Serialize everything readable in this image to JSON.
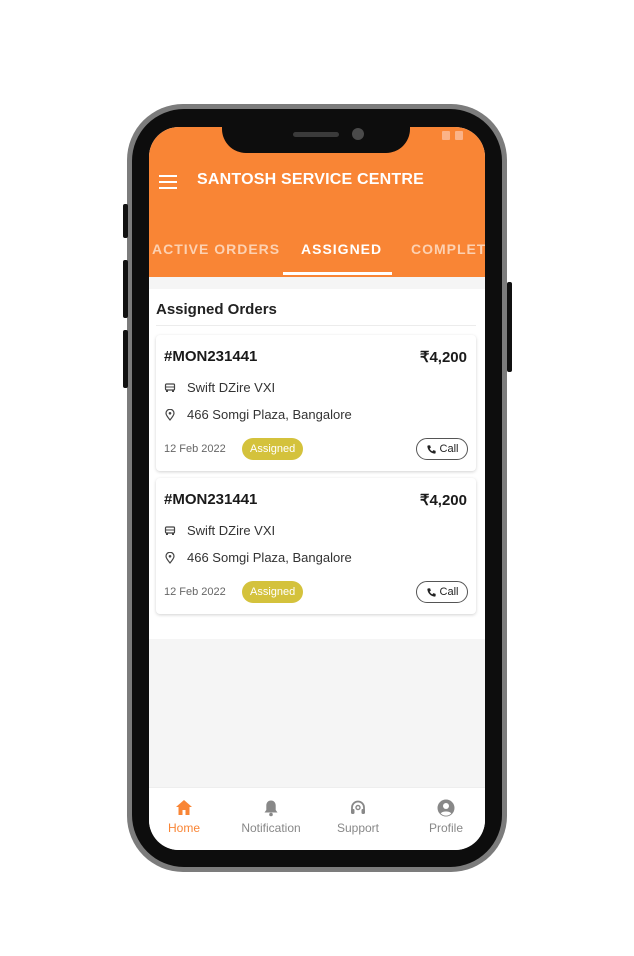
{
  "app": {
    "title": "SANTOSH SERVICE CENTRE"
  },
  "tabs": [
    {
      "label": "ACTIVE ORDERS"
    },
    {
      "label": "ASSIGNED"
    },
    {
      "label": "COMPLETED"
    }
  ],
  "section": {
    "title": "Assigned Orders"
  },
  "orders": [
    {
      "id": "#MON231441",
      "amount": "₹4,200",
      "car": "Swift DZire VXI",
      "location": "466 Somgi Plaza, Bangalore",
      "date": "12 Feb 2022",
      "status": "Assigned",
      "call_label": "Call"
    },
    {
      "id": "#MON231441",
      "amount": "₹4,200",
      "car": "Swift DZire VXI",
      "location": "466 Somgi Plaza, Bangalore",
      "date": "12 Feb 2022",
      "status": "Assigned",
      "call_label": "Call"
    }
  ],
  "bottom_nav": [
    {
      "label": "Home",
      "icon": "home-icon"
    },
    {
      "label": "Notification",
      "icon": "bell-icon"
    },
    {
      "label": "Support",
      "icon": "headset-icon"
    },
    {
      "label": "Profile",
      "icon": "user-circle-icon"
    }
  ],
  "colors": {
    "brand": "#f98535",
    "status_assigned": "#d4c23c"
  }
}
